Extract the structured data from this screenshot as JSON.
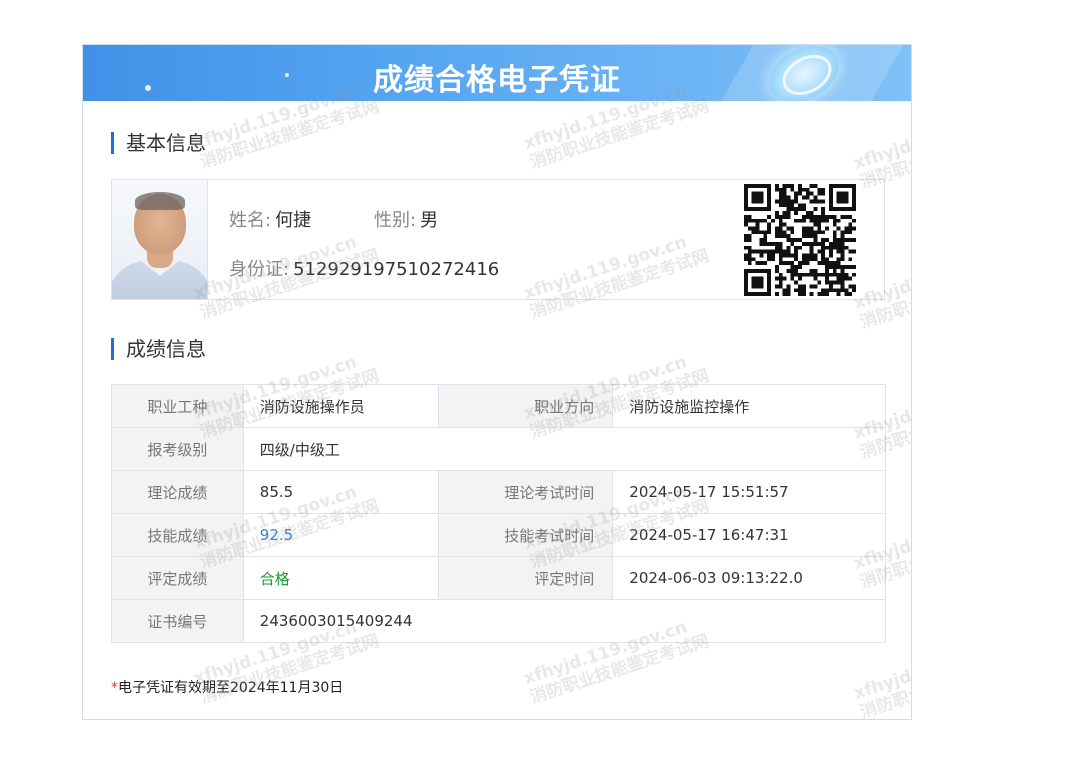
{
  "header": {
    "title": "成绩合格电子凭证"
  },
  "basic_info": {
    "section_title": "基本信息",
    "name_label": "姓名:",
    "name": "何捷",
    "gender_label": "性别:",
    "gender": "男",
    "id_label": "身份证:",
    "id_number": "512929197510272416"
  },
  "score_info": {
    "section_title": "成绩信息",
    "occupation_label": "职业工种",
    "occupation": "消防设施操作员",
    "direction_label": "职业方向",
    "direction": "消防设施监控操作",
    "level_label": "报考级别",
    "level": "四级/中级工",
    "theory_label": "理论成绩",
    "theory_score": "85.5",
    "theory_time_label": "理论考试时间",
    "theory_time": "2024-05-17 15:51:57",
    "skill_label": "技能成绩",
    "skill_score": "92.5",
    "skill_time_label": "技能考试时间",
    "skill_time": "2024-05-17 16:47:31",
    "eval_label": "评定成绩",
    "eval_result": "合格",
    "eval_time_label": "评定时间",
    "eval_time": "2024-06-03 09:13:22.0",
    "cert_label": "证书编号",
    "cert_number": "2436003015409244"
  },
  "footnote": {
    "star": "*",
    "text": "电子凭证有效期至2024年11月30日"
  },
  "watermark": {
    "line1": "xfhyjd.119.gov.cn",
    "line2": "消防职业技能鉴定考试网"
  },
  "colors": {
    "banner": "#4a9ef0",
    "accent": "#1f6fd6",
    "skill_score": "#2e83d6",
    "pass": "#1f9a3a",
    "star": "#e23a3a"
  }
}
